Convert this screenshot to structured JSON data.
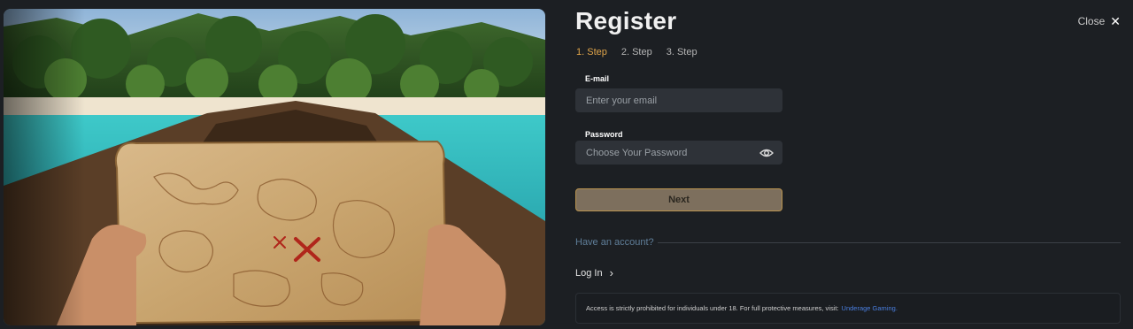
{
  "header": {
    "title": "Register",
    "close_label": "Close"
  },
  "steps": [
    {
      "label": "1. Step",
      "active": true
    },
    {
      "label": "2. Step",
      "active": false
    },
    {
      "label": "3. Step",
      "active": false
    }
  ],
  "form": {
    "email": {
      "label": "E-mail",
      "placeholder": "Enter your email",
      "value": ""
    },
    "password": {
      "label": "Password",
      "placeholder": "Choose Your Password",
      "value": ""
    },
    "next_label": "Next"
  },
  "account": {
    "prompt": "Have an account?",
    "login_label": "Log In"
  },
  "notice": {
    "text": "Access is strictly prohibited for individuals under 18. For full protective measures, visit:",
    "link": "Underage Gaming."
  },
  "icons": {
    "close": "close-icon",
    "eye": "eye-icon",
    "chevron": "chevron-right-icon"
  },
  "colors": {
    "background": "#1c1f23",
    "input": "#2e3238",
    "accent": "#e0a54a",
    "button": "#7d6f5d",
    "link": "#4a7fe0"
  }
}
